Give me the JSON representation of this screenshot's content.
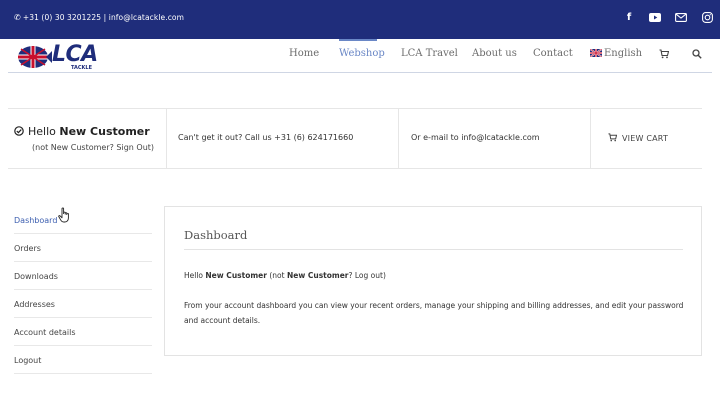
{
  "topbar": {
    "contact_text": "+31 (0) 30 3201225 | info@lcatackle.com",
    "icons": [
      "phone-icon",
      "facebook-icon",
      "youtube-icon",
      "mail-icon",
      "instagram-icon"
    ]
  },
  "logo": {
    "brand": "LCA",
    "tagline": "TACKLE"
  },
  "nav": {
    "home": "Home",
    "webshop": "Webshop",
    "travel": "LCA Travel",
    "about": "About us",
    "contact": "Contact",
    "language": "English"
  },
  "infobar": {
    "hello_prefix": "Hello",
    "customer_name": "New Customer",
    "not_customer": "(not New Customer? Sign Out)",
    "call_text": "Can't get it out? Call us +31 (6) 624171660",
    "email_text": "Or e-mail to  info@lcatackle.com",
    "view_cart": "VIEW CART"
  },
  "sidenav": {
    "items": [
      "Dashboard",
      "Orders",
      "Downloads",
      "Addresses",
      "Account details",
      "Logout"
    ],
    "active": "Dashboard"
  },
  "dashboard": {
    "title": "Dashboard",
    "hello_1": "Hello ",
    "name_1": "New Customer",
    "hello_2": " (not ",
    "name_2": "New Customer",
    "hello_3": "? Log out)",
    "body_1": "From your account dashboard you can view your ",
    "link_orders": "recent orders",
    "body_2": ", manage your ",
    "link_addresses": "shipping and billing addresses",
    "body_3": ", and ",
    "link_account": "edit your password and account details",
    "body_4": "."
  },
  "colors": {
    "topbar": "#1f2d7b",
    "accent": "#6a87c6",
    "link": "#3d5fb0"
  }
}
